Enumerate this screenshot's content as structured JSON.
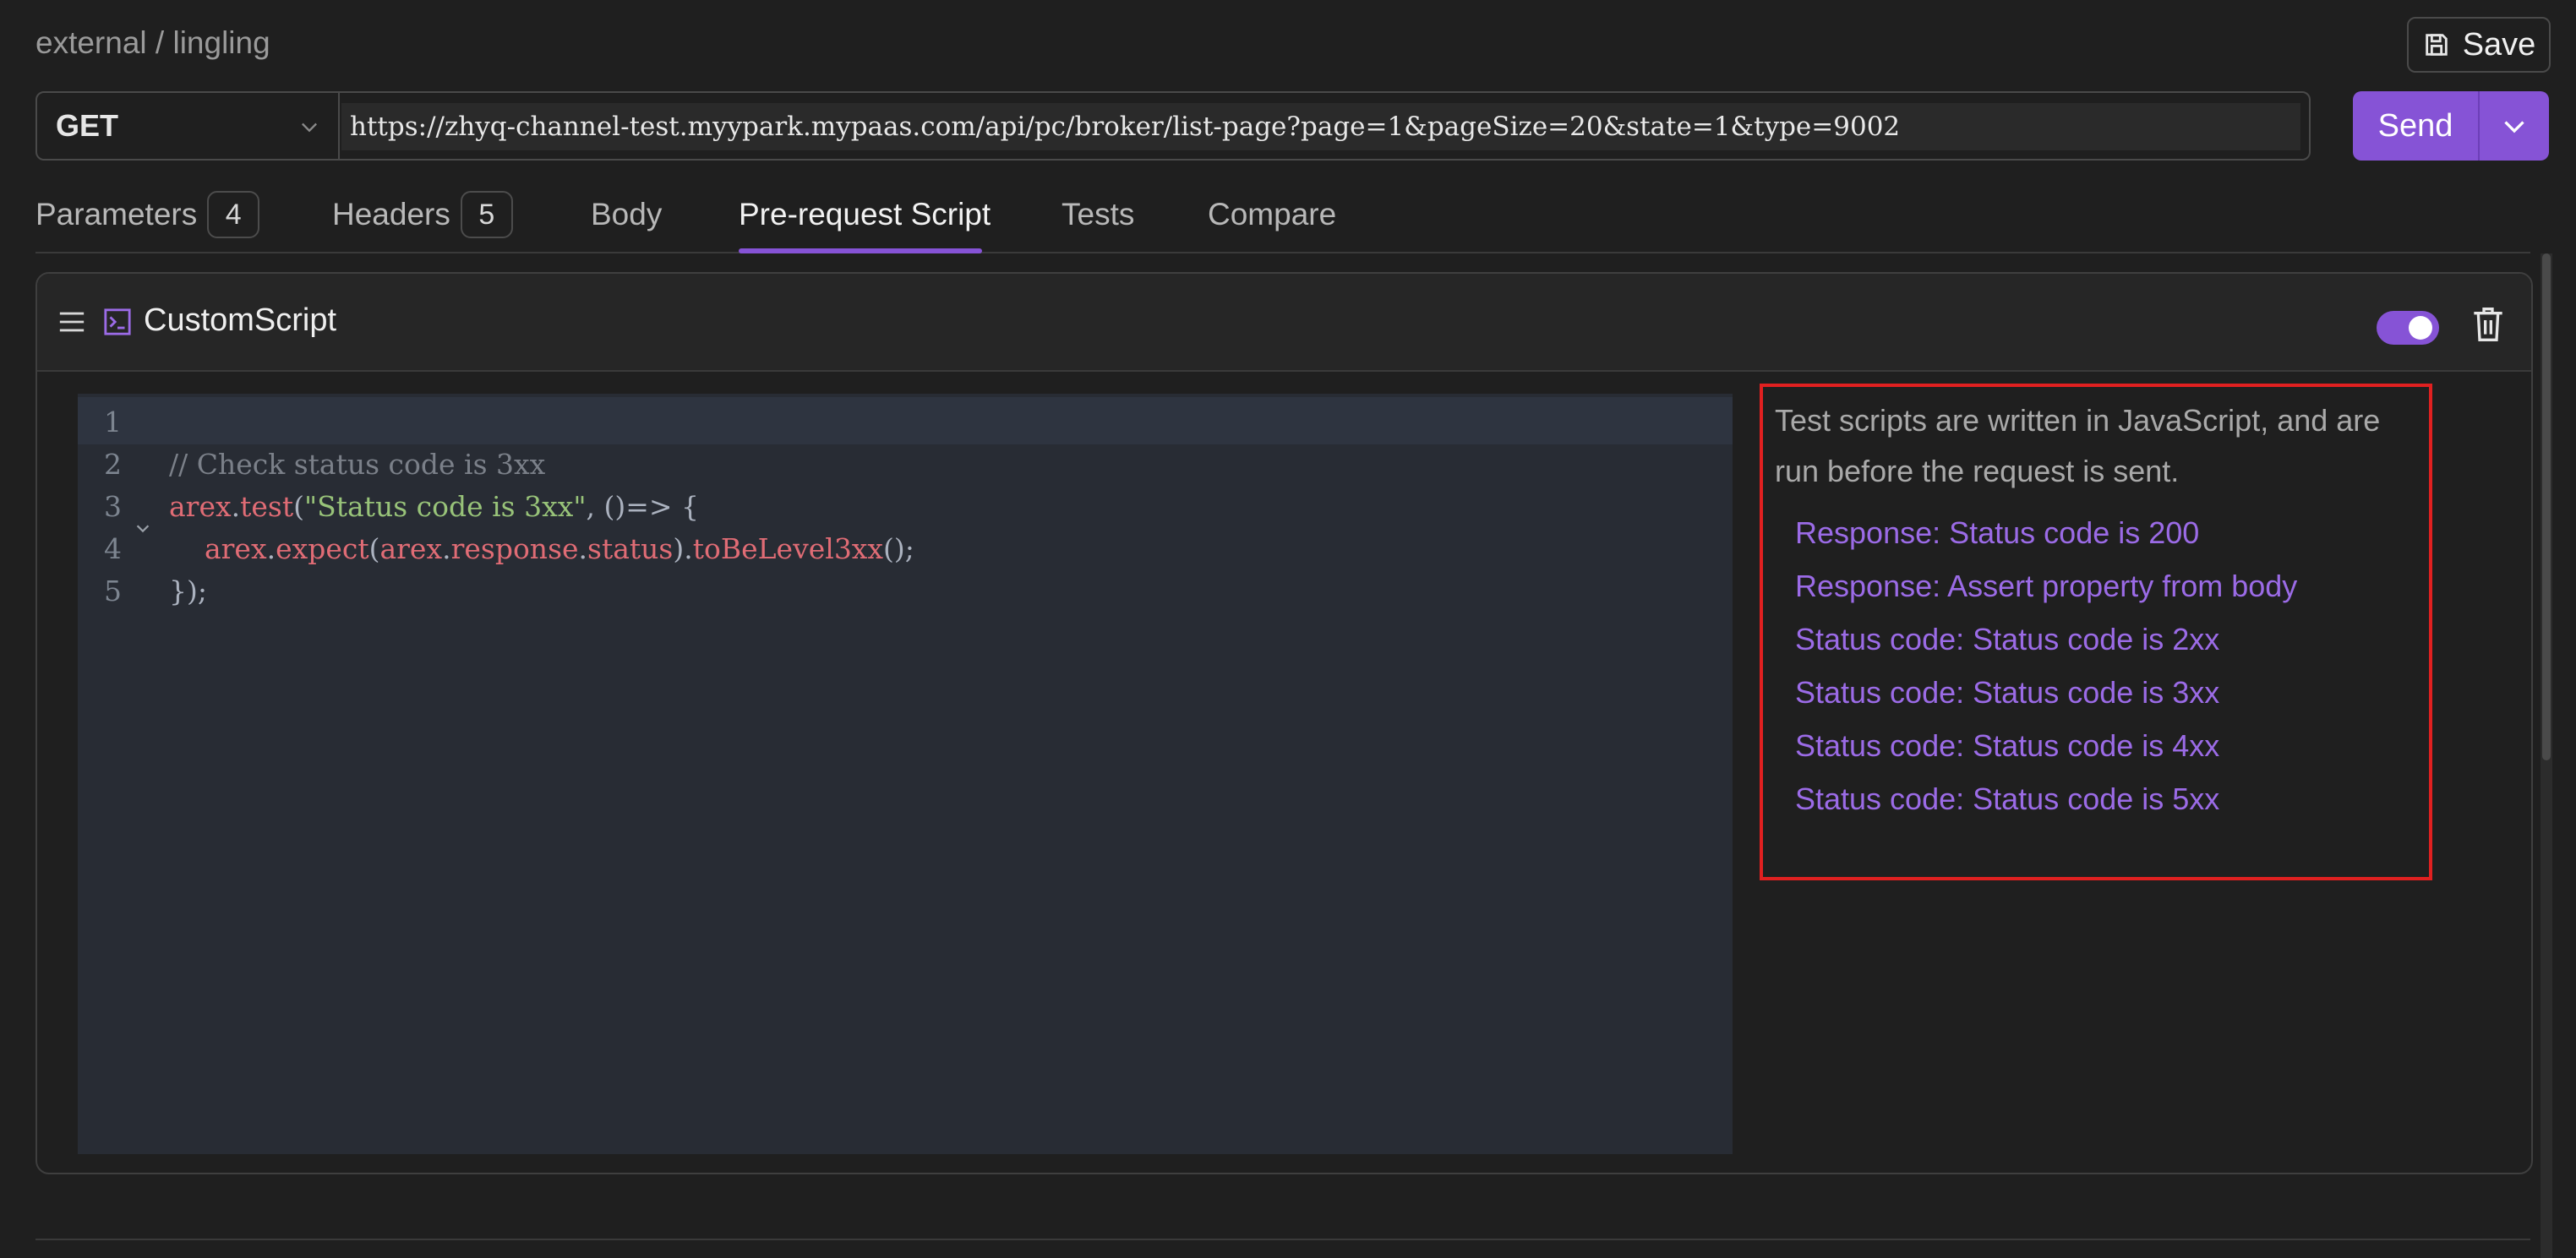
{
  "breadcrumb": "external / lingling",
  "toolbar": {
    "save_label": "Save"
  },
  "request": {
    "method": "GET",
    "url": "https://zhyq-channel-test.myypark.mypaas.com/api/pc/broker/list-page?page=1&pageSize=20&state=1&type=9002",
    "send_label": "Send"
  },
  "tabs": [
    {
      "label": "Parameters",
      "badge": "4"
    },
    {
      "label": "Headers",
      "badge": "5"
    },
    {
      "label": "Body"
    },
    {
      "label": "Pre-request Script",
      "active": true
    },
    {
      "label": "Tests"
    },
    {
      "label": "Compare"
    }
  ],
  "script": {
    "title": "CustomScript",
    "enabled": true,
    "line_numbers": [
      "1",
      "2",
      "3",
      "4",
      "5"
    ],
    "code": {
      "l2": "// Check status code is 3xx",
      "l3_a": "arex",
      "l3_b": ".",
      "l3_c": "test",
      "l3_d": "(",
      "l3_e": "\"Status code is 3xx\"",
      "l3_f": ", ()=> {",
      "l4_indent": "    ",
      "l4_a": "arex",
      "l4_b": ".",
      "l4_c": "expect",
      "l4_d": "(",
      "l4_e": "arex",
      "l4_f": ".",
      "l4_g": "response",
      "l4_h": ".",
      "l4_i": "status",
      "l4_j": ").",
      "l4_k": "toBeLevel3xx",
      "l4_l": "();",
      "l5": "});"
    }
  },
  "snippets": {
    "description": "Test scripts are written in JavaScript, and are run before the request is sent.",
    "items": [
      "Response: Status code is 200",
      "Response: Assert property from body",
      "Status code: Status code is 2xx",
      "Status code: Status code is 3xx",
      "Status code: Status code is 4xx",
      "Status code: Status code is 5xx"
    ]
  },
  "colors": {
    "accent": "#8653d6",
    "highlight_border": "#e02020",
    "snippet_link": "#9b6be6"
  }
}
